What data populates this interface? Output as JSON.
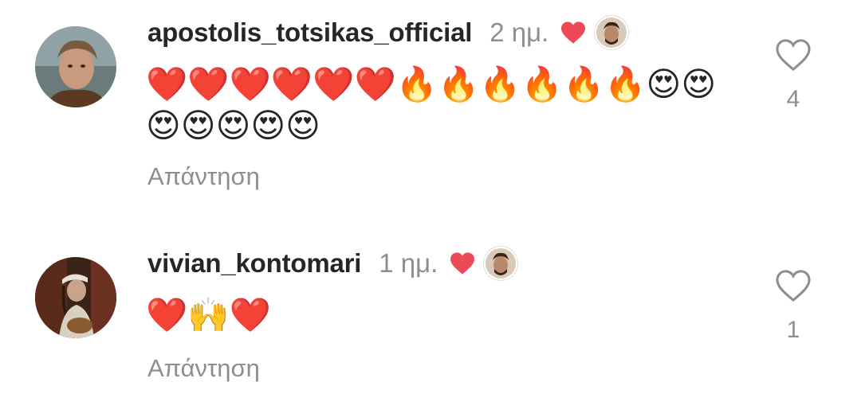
{
  "comments": [
    {
      "username": "apostolis_totsikas_official",
      "time": "2 ημ.",
      "text_line1": "❤️❤️❤️❤️❤️❤️🔥🔥🔥🔥🔥🔥😍😍",
      "text_line2": "😍😍😍😍😍",
      "reply_label": "Απάντηση",
      "like_count": "4",
      "liked_by_author": true
    },
    {
      "username": "vivian_kontomari",
      "time": "1 ημ.",
      "text_line1": "❤️🙌❤️",
      "text_line2": "",
      "reply_label": "Απάντηση",
      "like_count": "1",
      "liked_by_author": true
    }
  ],
  "colors": {
    "heart_red": "#ed4956",
    "text_primary": "#262626",
    "text_secondary": "#8e8e8e"
  },
  "icons": {
    "like": "heart-outline-icon",
    "author_liked": "heart-filled-icon"
  }
}
